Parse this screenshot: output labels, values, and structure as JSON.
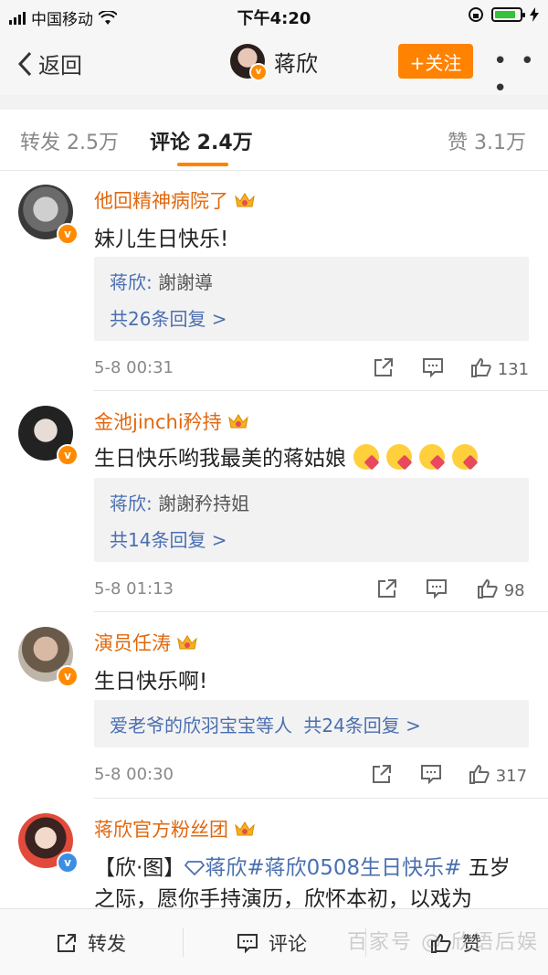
{
  "status": {
    "carrier": "中国移动",
    "time": "下午4:20"
  },
  "nav": {
    "back_label": "返回",
    "user_name": "蒋欣",
    "follow_label": "+关注",
    "more_label": "• • •"
  },
  "tabs": [
    {
      "label": "转发 2.5万"
    },
    {
      "label": "评论 2.4万"
    },
    {
      "label": "赞 3.1万"
    }
  ],
  "comments": [
    {
      "user": "他回精神病院了",
      "text": "妹儿生日快乐!",
      "reply_line1_name": "蒋欣:",
      "reply_line1_text": "謝謝導",
      "reply_line2": "共26条回复 >",
      "time": "5-8 00:31",
      "likes": "131"
    },
    {
      "user": "金池jinchi矜持",
      "text": "生日快乐哟我最美的蒋姑娘",
      "reply_line1_name": "蒋欣:",
      "reply_line1_text": "謝謝矜持姐",
      "reply_line2": "共14条回复 >",
      "time": "5-8 01:13",
      "likes": "98"
    },
    {
      "user": "演员任涛",
      "text": "生日快乐啊!",
      "reply_line1_name": "爱老爷的欣羽宝宝等人",
      "reply_line1_text": "共24条回复 >",
      "time": "5-8 00:30",
      "likes": "317"
    },
    {
      "user": "蒋欣官方粉丝团",
      "text_line1_prefix": "【欣·图】",
      "text_line1_topic": "蒋欣#蒋欣0508生日快乐#",
      "text_line1_suffix": " 五岁",
      "text_line2": "之际，愿你手持演历，欣怀本初，以戏为"
    }
  ],
  "bottom": {
    "repost_label": "转发",
    "comment_label": "评论",
    "like_label": "赞",
    "watermark": "百家号 @ 欣语后娱"
  },
  "colors": {
    "accent": "#ff8200",
    "username": "#e0680f",
    "link": "#4a6fb0",
    "verified_orange": "#ff8a00",
    "verified_blue": "#3a8fe4"
  }
}
